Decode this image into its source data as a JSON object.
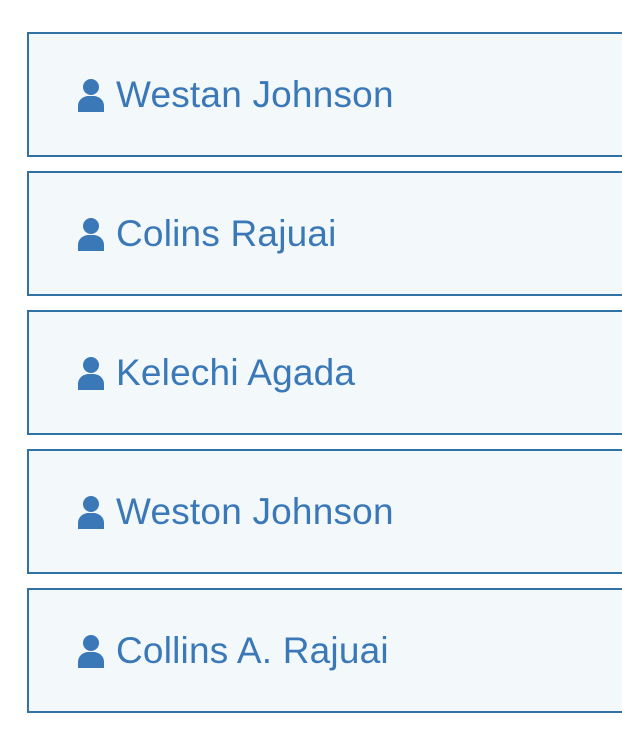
{
  "contacts": {
    "items": [
      {
        "name": "Westan Johnson",
        "icon": "user-icon"
      },
      {
        "name": "Colins Rajuai",
        "icon": "user-icon"
      },
      {
        "name": "Kelechi Agada",
        "icon": "user-icon"
      },
      {
        "name": "Weston Johnson",
        "icon": "user-icon"
      },
      {
        "name": "Collins A. Rajuai",
        "icon": "user-icon"
      }
    ]
  },
  "colors": {
    "accent": "#3a78b8",
    "border": "#2f72a3",
    "item_background": "#f3f8fb"
  }
}
